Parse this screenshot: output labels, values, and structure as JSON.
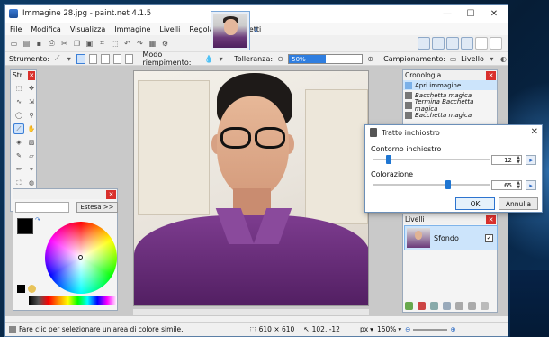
{
  "window": {
    "title": "Immagine 28.jpg - paint.net 4.1.5",
    "controls": {
      "minimize": "—",
      "maximize": "☐",
      "close": "✕"
    }
  },
  "menu": [
    "File",
    "Modifica",
    "Visualizza",
    "Immagine",
    "Livelli",
    "Regolazioni",
    "Effetti"
  ],
  "toolbar2": {
    "tool_label": "Strumento:",
    "fill_mode_label": "Modo riempimento:",
    "tolerance_label": "Tolleranza:",
    "tolerance_value": "50%",
    "tolerance_fraction": 0.5,
    "sampling_label": "Campionamento:",
    "sampling_value": "Livello"
  },
  "tools_panel": {
    "title": "Str..."
  },
  "history_panel": {
    "title": "Cronologia",
    "items": [
      "Apri immagine",
      "Bacchetta magica",
      "Termina Bacchetta magica",
      "Bacchetta magica"
    ]
  },
  "layers_panel": {
    "title": "Livelli",
    "layer_name": "Sfondo"
  },
  "colors_panel": {
    "expand_button": "Estesa >>"
  },
  "dialog": {
    "title": "Tratto inchiostro",
    "ink_outline_label": "Contorno inchiostro",
    "ink_outline_value": "12",
    "ink_outline_fraction": 0.12,
    "coloring_label": "Colorazione",
    "coloring_value": "65",
    "coloring_fraction": 0.65,
    "ok_label": "OK",
    "cancel_label": "Annulla"
  },
  "status": {
    "hint": "Fare clic per selezionare un'area di colore simile.",
    "image_size": "610 × 610",
    "cursor_pos": "102, -12",
    "unit": "px",
    "zoom": "150%"
  }
}
